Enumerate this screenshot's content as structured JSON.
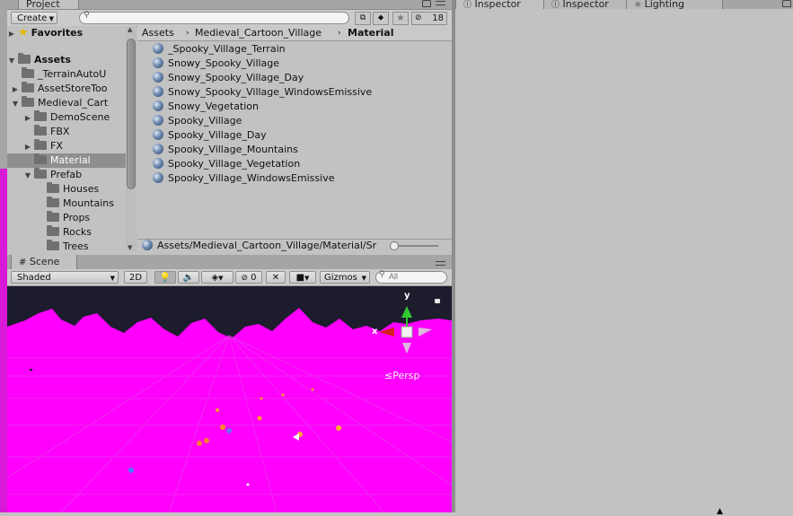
{
  "project": {
    "tab_label": "Project",
    "create_label": "Create",
    "search_placeholder": "",
    "hidden_count": "18",
    "favorites_label": "Favorites",
    "assets_label": "Assets",
    "tree": [
      {
        "label": "_TerrainAutoU",
        "indent": 1,
        "arrow": ""
      },
      {
        "label": "AssetStoreToo",
        "indent": 1,
        "arrow": "right"
      },
      {
        "label": "Medieval_Cart",
        "indent": 1,
        "arrow": "down"
      },
      {
        "label": "DemoScene",
        "indent": 2,
        "arrow": "right"
      },
      {
        "label": "FBX",
        "indent": 2,
        "arrow": ""
      },
      {
        "label": "FX",
        "indent": 2,
        "arrow": "right"
      },
      {
        "label": "Material",
        "indent": 2,
        "arrow": "",
        "selected": true
      },
      {
        "label": "Prefab",
        "indent": 2,
        "arrow": "down"
      },
      {
        "label": "Houses",
        "indent": 3,
        "arrow": ""
      },
      {
        "label": "Mountains",
        "indent": 3,
        "arrow": ""
      },
      {
        "label": "Props",
        "indent": 3,
        "arrow": ""
      },
      {
        "label": "Rocks",
        "indent": 3,
        "arrow": ""
      },
      {
        "label": "Trees",
        "indent": 3,
        "arrow": ""
      }
    ],
    "breadcrumb": [
      "Assets",
      "Medieval_Cartoon_Village",
      "Material"
    ],
    "materials": [
      "_Spooky_Village_Terrain",
      "Snowy_Spooky_Village",
      "Snowy_Spooky_Village_Day",
      "Snowy_Spooky_Village_WindowsEmissive",
      "Snowy_Vegetation",
      "Spooky_Village",
      "Spooky_Village_Day",
      "Spooky_Village_Mountains",
      "Spooky_Village_Vegetation",
      "Spooky_Village_WindowsEmissive"
    ],
    "status_path": "Assets/Medieval_Cartoon_Village/Material/Sr"
  },
  "scene": {
    "tab_label": "Scene",
    "shading_mode": "Shaded",
    "mode_2d": "2D",
    "hidden_count": "0",
    "gizmos_label": "Gizmos",
    "search_placeholder": "All",
    "axis_x": "x",
    "axis_y": "y",
    "persp_label": "Persp",
    "colors": {
      "sky": "#1c1c2c",
      "ground": "#ff00ff"
    }
  },
  "right_tabs": {
    "inspector_1": "Inspector",
    "inspector_2": "Inspector",
    "lighting": "Lighting"
  }
}
